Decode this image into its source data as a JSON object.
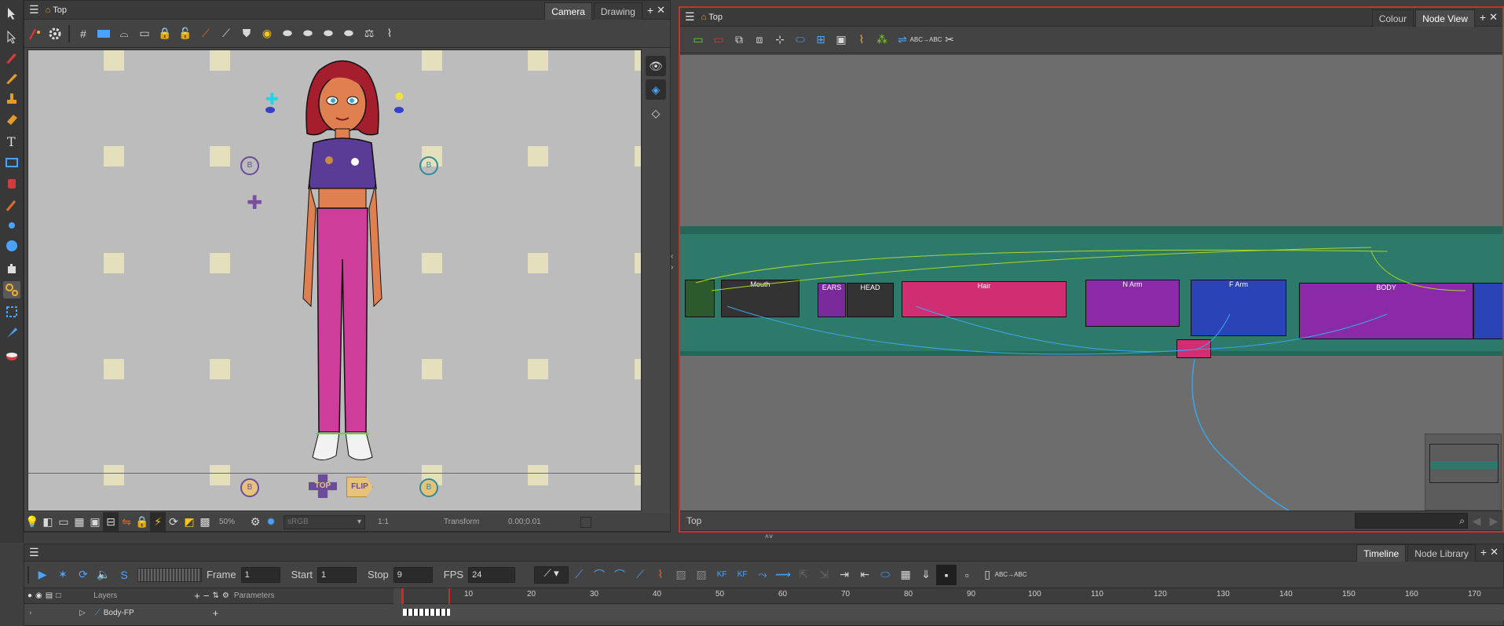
{
  "camera_panel": {
    "title": "Top",
    "tabs": [
      "Camera",
      "Drawing"
    ],
    "bottom": {
      "zoom": "50%",
      "colorspace": "sRGB",
      "ratio": "1:1",
      "mode": "Transform",
      "coords": "0.00;0.01"
    }
  },
  "canvas_labels": {
    "top": "TOP",
    "flip": "FLIP",
    "b_label": "B"
  },
  "node_panel": {
    "title": "Top",
    "tabs": [
      "Colour",
      "Node View"
    ],
    "footer": "Top",
    "search_placeholder": "",
    "icons_label": "ABC→ABC",
    "groups": [
      {
        "label": "Mouth"
      },
      {
        "label": "EARS"
      },
      {
        "label": "HEAD"
      },
      {
        "label": "Hair"
      },
      {
        "label": "N Arm"
      },
      {
        "label": "F Arm"
      },
      {
        "label": "BODY"
      }
    ]
  },
  "timeline_panel": {
    "tabs": [
      "Timeline",
      "Node Library"
    ],
    "playback": {
      "frame_label": "Frame",
      "frame": "1",
      "start_label": "Start",
      "start": "1",
      "stop_label": "Stop",
      "stop": "9",
      "fps_label": "FPS",
      "fps": "24"
    },
    "layers_header": "Layers",
    "parameters_header": "Parameters",
    "layer_name": "Body-FP",
    "ruler": [
      "10",
      "20",
      "30",
      "40",
      "50",
      "60",
      "70",
      "80",
      "90",
      "100",
      "110",
      "120",
      "130",
      "140",
      "150",
      "160",
      "170"
    ],
    "abc_label": "ABC→ABC"
  },
  "colors": {
    "accent_red": "#c8322d",
    "node_bg": "#2d7a6a",
    "timeline_playhead": "#d32626"
  }
}
